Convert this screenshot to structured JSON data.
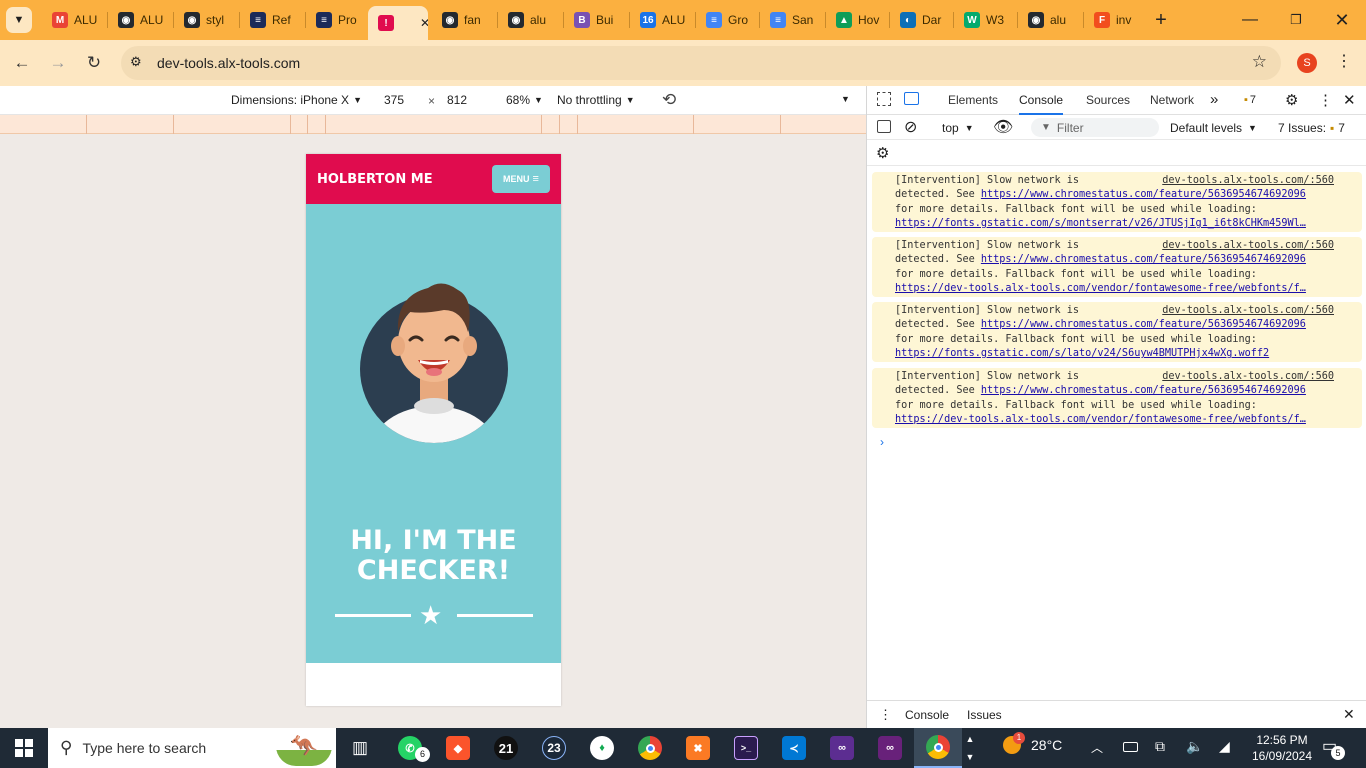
{
  "browser": {
    "tabs": [
      {
        "title": "ALU",
        "icon": "gmail-icon",
        "color": "#ea4335",
        "glyph": "M"
      },
      {
        "title": "ALU",
        "icon": "github-icon",
        "color": "#24292f",
        "glyph": "◉"
      },
      {
        "title": "styl",
        "icon": "github-icon",
        "color": "#24292f",
        "glyph": "◉"
      },
      {
        "title": "Ref",
        "icon": "intranet-icon",
        "color": "#1c2b59",
        "glyph": "≡"
      },
      {
        "title": "Pro",
        "icon": "intranet-icon",
        "color": "#1c2b59",
        "glyph": "≡"
      },
      {
        "title": "",
        "icon": "holberton-icon",
        "color": "#e00c4e",
        "glyph": "!",
        "active": true
      },
      {
        "title": "fan",
        "icon": "github-icon",
        "color": "#24292f",
        "glyph": "◉"
      },
      {
        "title": "alu",
        "icon": "github-icon",
        "color": "#24292f",
        "glyph": "◉"
      },
      {
        "title": "Bui",
        "icon": "bootstrap-icon",
        "color": "#7952b3",
        "glyph": "B"
      },
      {
        "title": "ALU",
        "icon": "calendar-icon",
        "color": "#1a73e8",
        "glyph": "16"
      },
      {
        "title": "Gro",
        "icon": "docs-icon",
        "color": "#4285f4",
        "glyph": "≡"
      },
      {
        "title": "San",
        "icon": "docs-icon",
        "color": "#4285f4",
        "glyph": "≡"
      },
      {
        "title": "Hov",
        "icon": "drive-icon",
        "color": "#0f9d58",
        "glyph": "▲"
      },
      {
        "title": "Dar",
        "icon": "edge-icon",
        "color": "#0c6fb8",
        "glyph": "◐"
      },
      {
        "title": "W3",
        "icon": "w3schools-icon",
        "color": "#04aa6d",
        "glyph": "W"
      },
      {
        "title": "alu",
        "icon": "github-icon",
        "color": "#24292f",
        "glyph": "◉"
      },
      {
        "title": "inv",
        "icon": "figma-icon",
        "color": "#f24e1e",
        "glyph": "F"
      }
    ],
    "url": "dev-tools.alx-tools.com",
    "profile_initial": "S",
    "profile_color": "#e8431f"
  },
  "device_toolbar": {
    "dimensions_label": "Dimensions: iPhone X",
    "width": "375",
    "times": "×",
    "height": "812",
    "zoom": "68%",
    "throttling": "No throttling"
  },
  "page": {
    "brand": "HOLBERTON ME",
    "menu_label": "MENU",
    "hero_title_line1": "HI, I'M THE",
    "hero_title_line2": "CHECKER!"
  },
  "devtools": {
    "tabs": [
      "Elements",
      "Console",
      "Sources",
      "Network"
    ],
    "selected_tab": "Console",
    "message_badge": "7",
    "context": "top",
    "filter_placeholder": "Filter",
    "levels": "Default levels",
    "issues_label": "7 Issues:",
    "issues_count": "7",
    "messages": [
      {
        "text1": "[Intervention] Slow network is",
        "source": "dev-tools.alx-tools.com/:560",
        "text2": "detected. See ",
        "link1": "https://www.chromestatus.com/feature/5636954674692096",
        "text3": "for more details. Fallback font will be used while loading:",
        "link2": "https://fonts.gstatic.com/s/montserrat/v26/JTUSjIg1_i6t8kCHKm459Wl…"
      },
      {
        "text1": "[Intervention] Slow network is",
        "source": "dev-tools.alx-tools.com/:560",
        "text2": "detected. See ",
        "link1": "https://www.chromestatus.com/feature/5636954674692096",
        "text3": "for more details. Fallback font will be used while loading:",
        "link2": "https://dev-tools.alx-tools.com/vendor/fontawesome-free/webfonts/f…"
      },
      {
        "text1": "[Intervention] Slow network is",
        "source": "dev-tools.alx-tools.com/:560",
        "text2": "detected. See ",
        "link1": "https://www.chromestatus.com/feature/5636954674692096",
        "text3": "for more details. Fallback font will be used while loading:",
        "link2": "https://fonts.gstatic.com/s/lato/v24/S6uyw4BMUTPHjx4wXg.woff2"
      },
      {
        "text1": "[Intervention] Slow network is",
        "source": "dev-tools.alx-tools.com/:560",
        "text2": "detected. See ",
        "link1": "https://www.chromestatus.com/feature/5636954674692096",
        "text3": "for more details. Fallback font will be used while loading:",
        "link2": "https://dev-tools.alx-tools.com/vendor/fontawesome-free/webfonts/f…"
      }
    ],
    "drawer_tabs": [
      "Console",
      "Issues"
    ]
  },
  "taskbar": {
    "search_placeholder": "Type here to search",
    "whatsapp_badge": "6",
    "app_21": "21",
    "app_23": "23",
    "weather": "28°C",
    "weather_badge": "1",
    "time": "12:56 PM",
    "date": "16/09/2024",
    "notification_count": "5"
  }
}
